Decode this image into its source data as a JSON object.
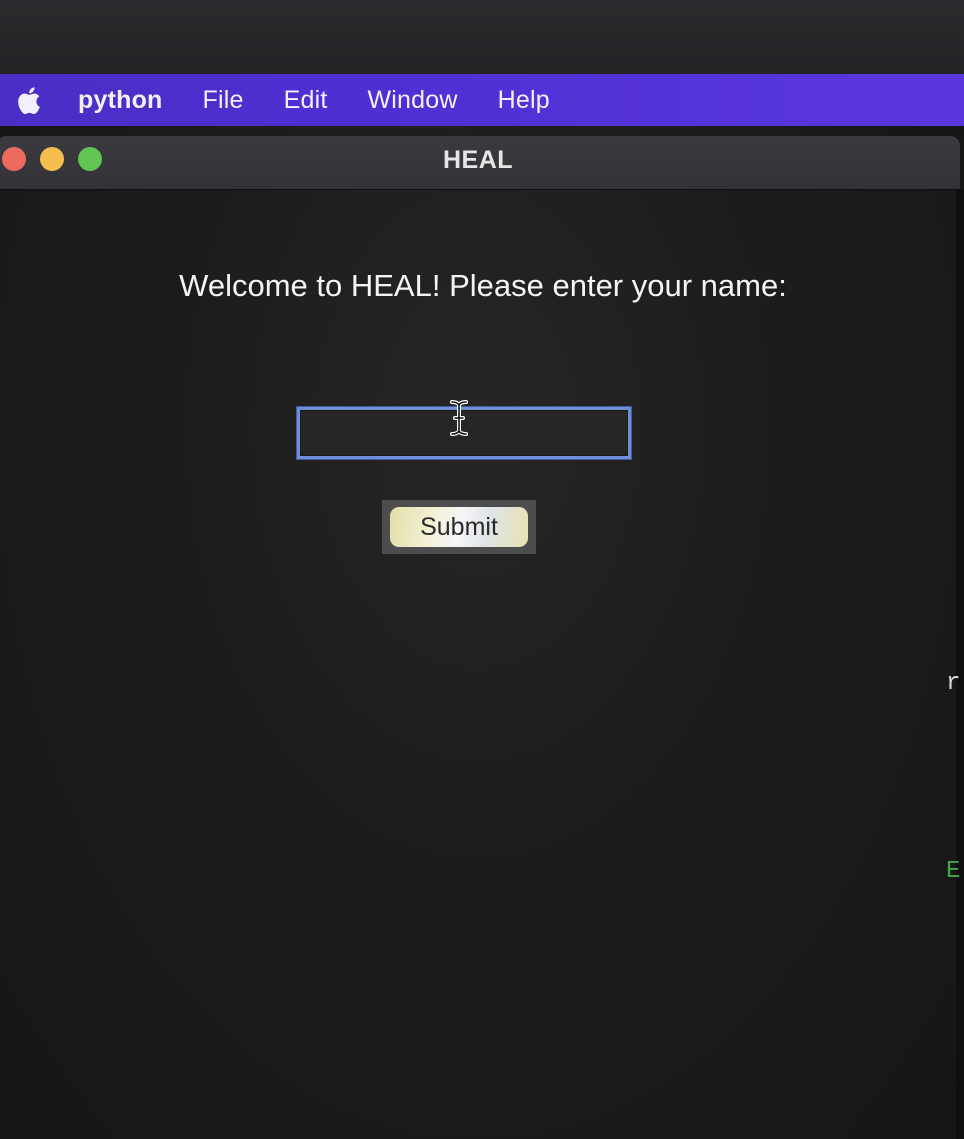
{
  "menubar": {
    "apple_icon": "apple-logo-icon",
    "app_name": "python",
    "items": [
      "File",
      "Edit",
      "Window",
      "Help"
    ]
  },
  "window": {
    "title": "HEAL",
    "traffic_lights": {
      "close_color": "#ec6a5e",
      "minimize_color": "#f4bf4f",
      "maximize_color": "#61c554"
    }
  },
  "form": {
    "prompt": "Welcome to HEAL! Please enter your name:",
    "name_value": "",
    "submit_label": "Submit"
  },
  "background_edge": {
    "glyph_top": "r",
    "glyph_bottom": "E"
  },
  "colors": {
    "menubar_accent": "#4f2fd3",
    "input_focus_border": "#6f8fd8"
  }
}
